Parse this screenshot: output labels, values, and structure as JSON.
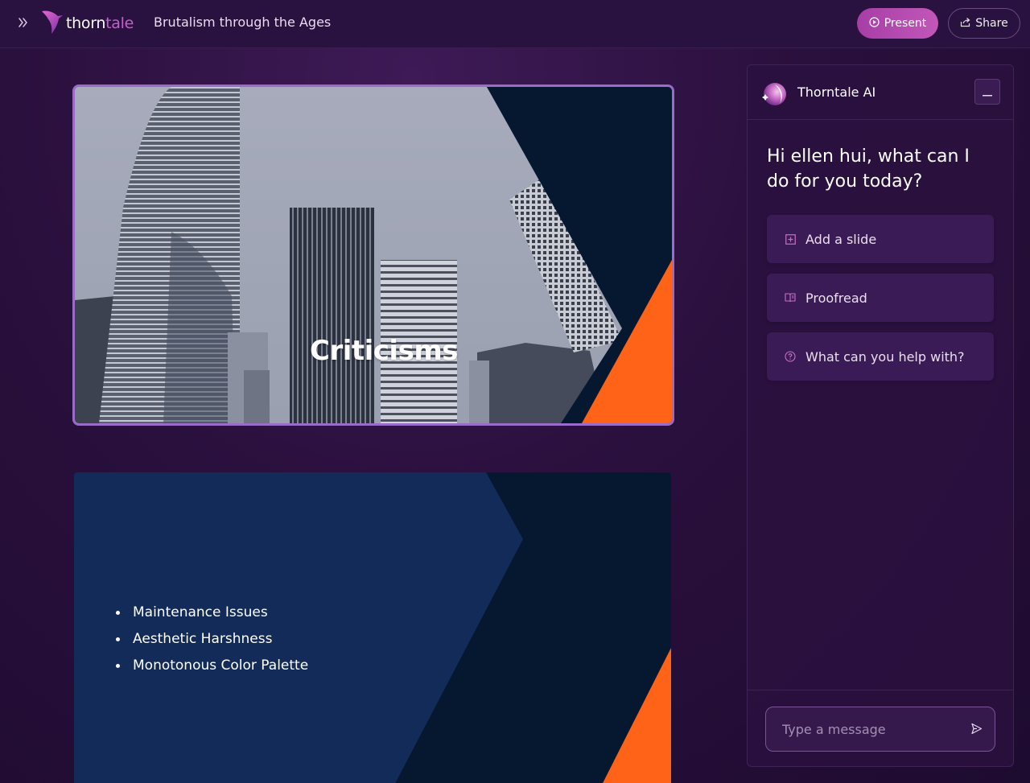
{
  "app": {
    "logo_part1": "thorn",
    "logo_part2": "tale",
    "document_title": "Brutalism through the Ages"
  },
  "header": {
    "expand_icon": "double-chevron-right-icon",
    "present_label": "Present",
    "share_label": "Share"
  },
  "slides": [
    {
      "title": "Criticisms",
      "accent_color": "#ff6317"
    },
    {
      "bullets": [
        "Maintenance Issues",
        "Aesthetic Harshness",
        "Monotonous Color Palette"
      ],
      "accent_color": "#ff6317"
    }
  ],
  "ai_panel": {
    "title": "Thorntale AI",
    "greeting": "Hi ellen hui, what can I do for you today?",
    "suggestions": [
      {
        "label": "Add a slide",
        "icon": "plus-square-icon"
      },
      {
        "label": "Proofread",
        "icon": "book-open-icon"
      },
      {
        "label": "What can you help with?",
        "icon": "help-circle-icon"
      }
    ],
    "message_placeholder": "Type a message"
  },
  "colors": {
    "brand_pink": "#c062c8",
    "slide_orange": "#ff6317",
    "slide_navy": "#132b59",
    "slide_dark": "#051830"
  }
}
